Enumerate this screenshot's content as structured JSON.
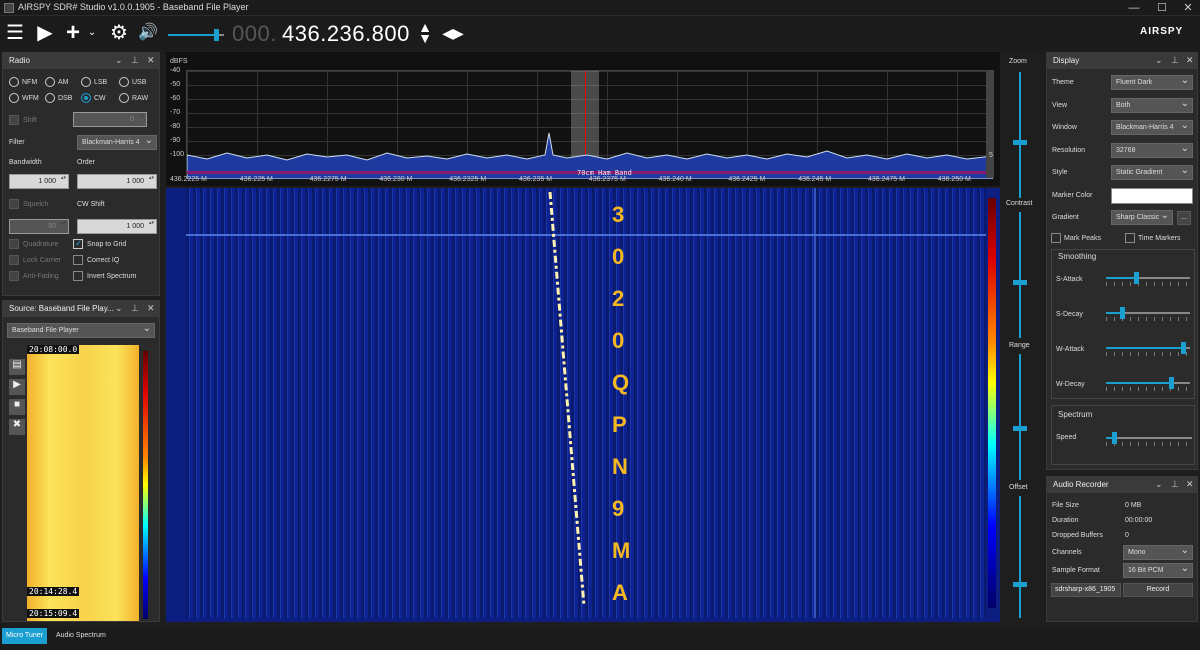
{
  "window": {
    "title": "AIRSPY SDR# Studio v1.0.0.1905 - Baseband File Player",
    "min": "—",
    "max": "☐",
    "close": "✕"
  },
  "toolbar": {
    "freq_dim": "000.",
    "freq": "436.236.800",
    "logo": "AIRSPY"
  },
  "radio": {
    "title": "Radio",
    "modes": [
      "NFM",
      "AM",
      "LSB",
      "USB",
      "WFM",
      "DSB",
      "CW",
      "RAW"
    ],
    "selected_mode": "CW",
    "shift_label": "Shift",
    "shift_value": "0",
    "filter_label": "Filter",
    "filter_value": "Blackman-Harris 4",
    "bandwidth_label": "Bandwidth",
    "order_label": "Order",
    "bandwidth_value": "1 000",
    "order_value": "1 000",
    "squelch_label": "Squelch",
    "cwshift_label": "CW Shift",
    "squelch_value": "50",
    "cwshift_value": "1 000",
    "options": [
      {
        "label": "Quadrature",
        "checked": false,
        "disabled": true
      },
      {
        "label": "Snap to Grid",
        "checked": true,
        "disabled": false
      },
      {
        "label": "Lock Carrier",
        "checked": false,
        "disabled": true
      },
      {
        "label": "Correct IQ",
        "checked": false,
        "disabled": false
      },
      {
        "label": "Anti-Fading",
        "checked": false,
        "disabled": true
      },
      {
        "label": "Invert Spectrum",
        "checked": false,
        "disabled": false
      }
    ]
  },
  "source": {
    "title": "Source: Baseband File Play...",
    "device": "Baseband File Player",
    "time_top": "20:08:00.0",
    "time_mid": "20:14:28.4",
    "time_bot": "20:15:09.4"
  },
  "spectrum": {
    "ylabel": "dBFS",
    "yticks": [
      "-40",
      "-50",
      "-60",
      "-70",
      "-80",
      "-90",
      "-100"
    ],
    "xticks": [
      "436.2225 M",
      "436.225 M",
      "436.2275 M",
      "436.230 M",
      "436.2325 M",
      "436.235 M",
      "436.2375 M",
      "436.240 M",
      "436.2425 M",
      "436.245 M",
      "436.2475 M",
      "436.250 M"
    ],
    "band_label": "70cm Ham Band",
    "side_value": "5"
  },
  "waterfall": {
    "letters": [
      "3",
      "0",
      "2",
      "0",
      "Q",
      "P",
      "N",
      "9",
      "M",
      "A"
    ]
  },
  "sliders": {
    "zoom": "Zoom",
    "contrast": "Contrast",
    "range": "Range",
    "offset": "Offset"
  },
  "display": {
    "title": "Display",
    "rows": [
      {
        "label": "Theme",
        "value": "Fluent Dark"
      },
      {
        "label": "View",
        "value": "Both"
      },
      {
        "label": "Window",
        "value": "Blackman-Harris 4"
      },
      {
        "label": "Resolution",
        "value": "32768"
      },
      {
        "label": "Style",
        "value": "Static Gradient"
      },
      {
        "label": "Marker Color",
        "value": ""
      },
      {
        "label": "Gradient",
        "value": "Sharp Classic"
      }
    ],
    "gradient_btn": "...",
    "mark_peaks": "Mark Peaks",
    "time_markers": "Time Markers",
    "smoothing_title": "Smoothing",
    "smoothing": [
      {
        "label": "S-Attack",
        "level": 0.35
      },
      {
        "label": "S-Decay",
        "level": 0.18
      },
      {
        "label": "W-Attack",
        "level": 0.95
      },
      {
        "label": "W-Decay",
        "level": 0.8
      }
    ],
    "spectrum_title": "Spectrum",
    "speed_label": "Speed",
    "speed_level": 0.08
  },
  "recorder": {
    "title": "Audio Recorder",
    "file_size_label": "File Size",
    "file_size": "0 MB",
    "duration_label": "Duration",
    "duration": "00:00:00",
    "dropped_label": "Dropped Buffers",
    "dropped": "0",
    "channels_label": "Channels",
    "channels": "Mono",
    "format_label": "Sample Format",
    "format": "16 Bit PCM",
    "filename": "sdrsharp-x86_1905",
    "record": "Record"
  },
  "tabs": {
    "micro_tuner": "Micro Tuner",
    "audio_spectrum": "Audio Spectrum"
  }
}
